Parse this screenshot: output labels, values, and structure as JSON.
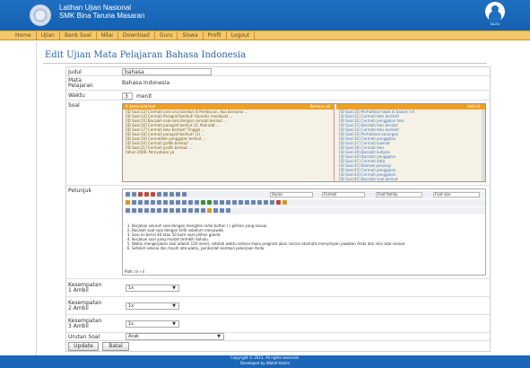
{
  "header": {
    "line1": "Latihan Ujian Nasional",
    "line2": "SMK Bina Taruna Masaran",
    "user_label": "Guru"
  },
  "nav": [
    "Home",
    "Ujian",
    "Bank Soal",
    "Nilai",
    "Download",
    "Guru",
    "Siswa",
    "Profil",
    "Logout"
  ],
  "page_title": "Edit Ujian Mata Pelajaran Bahasa Indonesia",
  "form": {
    "judul_label": "Judul",
    "judul_value": "bahasa",
    "mapel_label": "Mata\nPelajaran",
    "mapel_value": "Bahasa Indonesia",
    "waktu_label": "Waktu",
    "waktu_value": "3",
    "waktu_unit": "menit",
    "soal_label": "Soal",
    "selected_header": "8 items selected",
    "selected_remove_all": "Remove all",
    "available_add_all": "Add all",
    "selected_items": [
      "[ID Soal:13] Cermati cara arca berikut di Pemburan, dua bersama ...",
      "[ID Soal:14] Cermati Paragraf berikut! Hipnotis membuat ...",
      "[ID Soal:15] Bacalah soal-soal dengan cermati berikut ...",
      "[ID Soal:16] Cermati paragraf berikut (1) Alat-alat ...",
      "[ID Soal:17] Cermati teks berikut! Tinggal ...",
      "[ID Soal:18] Cermati paragraf berikut! (1) ...",
      "[ID Soal:19] Cermatilah penggalan berikut ...",
      "[ID Soal:20] Cermati grafik berikut! ...",
      "[ID Soal:21] Cermati grafik berikut ...",
      "tahun 2008. Pernyataan ya"
    ],
    "available_items": [
      "[ID Soal:30] Perhatikan tabel di bawah ini!",
      "[ID Soal:31] Cermati teks berikut!",
      "[ID Soal:32] Cermati penggalan teks",
      "[ID Soal:33] Bacalah teks berikut",
      "[ID Soal:34] Cermati teks berikut!",
      "[ID Soal:35] Perhatikan karangan",
      "[ID Soal:36] Cermati penggalan",
      "[ID Soal:37] Cermati kalimat",
      "[ID Soal:38] Cermati teks",
      "[ID Soal:39] Bacalah kutipan",
      "[ID Soal:40] Bacalah penggalan",
      "[ID Soal:41] Cermati data",
      "[ID Soal:42] Kalimat penutup",
      "[ID Soal:43] Cermati penggalan",
      "[ID Soal:44] Cermati penggalan",
      "[ID Soal:45] Bacalah soal berikut"
    ],
    "petunjuk_label": "Petunjuk",
    "editor_dropdowns": [
      "Styles",
      "Format",
      "Font family",
      "Font size"
    ],
    "petunjuk_list": [
      "Kerjakan seluruh soal dengan mengklik radio button ( ) pilihan yang sesuai.",
      "Bacalah soal-soal dengan teliti sebelum menjawab.",
      "Soal ini berisi 40 atau 50 butir soal pilihan ganda.",
      "Kerjakan soal yang mudah terlebih dahulu.",
      "Waktu mengerjakan soal adalah 120 menit, setelah waktu selesai maka program akan secara otomatis menyimpan jawaban Anda dan nilai akan keluar.",
      "Setelah selesai dan masih ada waktu, periksalah kembali pekerjaan Anda."
    ],
    "editor_path": "Path: ol » li",
    "kesempatan_a_label": "Kesempatan\n1 Ambil",
    "kesempatan_a_value": "1x",
    "kesempatan_b_label": "Kesempatan\n2 Ambil",
    "kesempatan_b_value": "1x",
    "kesempatan_c_label": "Kesempatan\n3 Ambil",
    "kesempatan_c_value": "1x",
    "urutan_label": "Urutan Soal",
    "urutan_value": "Acak",
    "update_button": "Update",
    "batal_button": "Batal"
  },
  "footer": {
    "line1": "Copyright © 2013, All rights reserved.",
    "line2": "Developed by Wahid Hasim"
  }
}
